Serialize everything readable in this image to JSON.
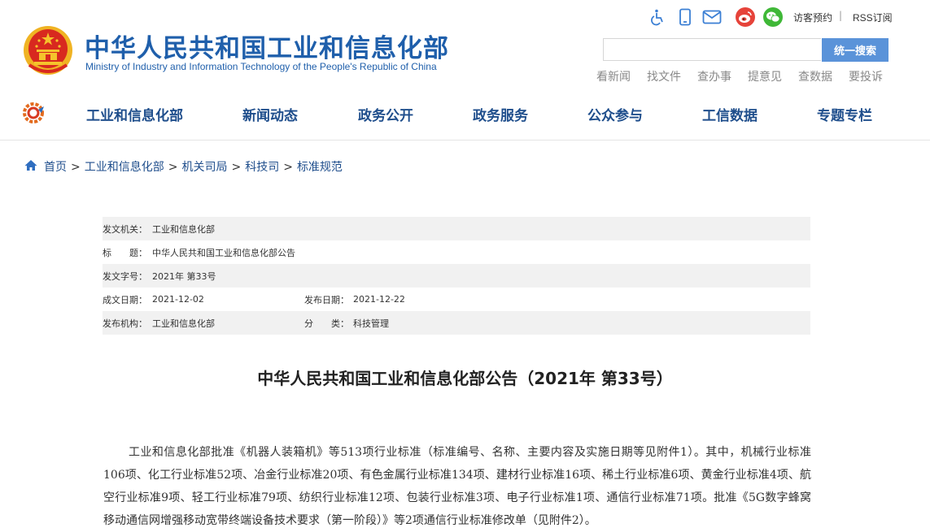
{
  "header": {
    "title": "中华人民共和国工业和信息化部",
    "subtitle": "Ministry of Industry and Information Technology of the People's Republic of China",
    "tools": {
      "icons": [
        "accessibility-icon",
        "mobile-icon",
        "mail-icon",
        "weibo-icon",
        "wechat-icon"
      ],
      "visitor_label": "访客预约",
      "separator": "|",
      "rss_label": "RSS订阅"
    },
    "search": {
      "placeholder": "",
      "button_label": "统一搜索"
    },
    "quick_links": [
      "看新闻",
      "找文件",
      "查办事",
      "提意见",
      "查数据",
      "要投诉"
    ]
  },
  "nav": {
    "items": [
      "工业和信息化部",
      "新闻动态",
      "政务公开",
      "政务服务",
      "公众参与",
      "工信数据",
      "专题专栏"
    ]
  },
  "breadcrumb": {
    "items": [
      "首页",
      "工业和信息化部",
      "机关司局",
      "科技司",
      "标准规范"
    ],
    "separator": ">"
  },
  "meta": {
    "issuer_label": "发文机关：",
    "issuer": "工业和信息化部",
    "title_label": "标　　题：",
    "title": "中华人民共和国工业和信息化部公告",
    "doc_no_label": "发文字号：",
    "doc_no": "2021年 第33号",
    "created_label": "成文日期：",
    "created": "2021-12-02",
    "published_label": "发布日期：",
    "published": "2021-12-22",
    "org_label": "发布机构：",
    "org": "工业和信息化部",
    "category_label": "分　　类：",
    "category": "科技管理"
  },
  "article": {
    "title": "中华人民共和国工业和信息化部公告（2021年 第33号）",
    "body": "工业和信息化部批准《机器人装箱机》等513项行业标准（标准编号、名称、主要内容及实施日期等见附件1）。其中，机械行业标准106项、化工行业标准52项、冶金行业标准20项、有色金属行业标准134项、建材行业标准16项、稀土行业标准6项、黄金行业标准4项、航空行业标准9项、轻工行业标准79项、纺织行业标准12项、包装行业标准3项、电子行业标准1项、通信行业标准71项。批准《5G数字蜂窝移动通信网增强移动宽带终端设备技术要求（第一阶段）》等2项通信行业标准修改单（见附件2）。"
  },
  "colors": {
    "brand_blue": "#1f5fab",
    "nav_blue": "#1f4e8c",
    "search_button": "#5a93d9",
    "meta_shade": "#f1f1f1",
    "weibo_red": "#e6433a",
    "wechat_green": "#3fb837"
  }
}
